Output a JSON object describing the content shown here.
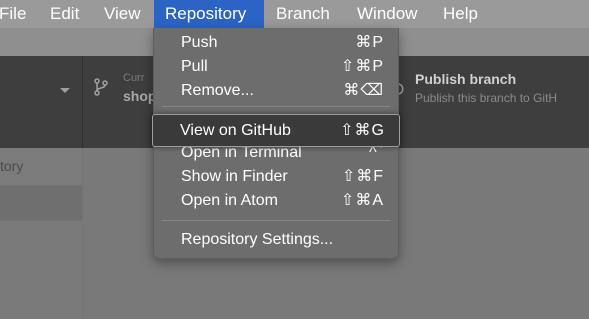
{
  "menubar": {
    "items": [
      "File",
      "Edit",
      "View",
      "Repository",
      "Branch",
      "Window",
      "Help"
    ],
    "active": "Repository"
  },
  "toolbar": {
    "current_label": "Curr",
    "current_value": "shop",
    "publish_title": "Publish branch",
    "publish_sub": "Publish this branch to GitH"
  },
  "sidebar": {
    "history_tab": "tory"
  },
  "repository_menu": {
    "items": [
      {
        "label": "Push",
        "shortcut": "⌘P"
      },
      {
        "label": "Pull",
        "shortcut": "⇧⌘P"
      },
      {
        "label": "Remove...",
        "shortcut": "⌘⌫"
      },
      {
        "label": "View on GitHub",
        "shortcut": "⇧⌘G"
      },
      {
        "label": "Open in Terminal",
        "shortcut": "^`"
      },
      {
        "label": "Show in Finder",
        "shortcut": "⇧⌘F"
      },
      {
        "label": "Open in Atom",
        "shortcut": "⇧⌘A"
      },
      {
        "label": "Repository Settings..."
      }
    ],
    "highlighted": "View on GitHub"
  },
  "colors": {
    "menubar_bg": "#9a9a9a",
    "active_menu": "#2c64c5",
    "menu_bg": "#6d6d6d",
    "toolbar_bg": "#3e3e3e"
  }
}
